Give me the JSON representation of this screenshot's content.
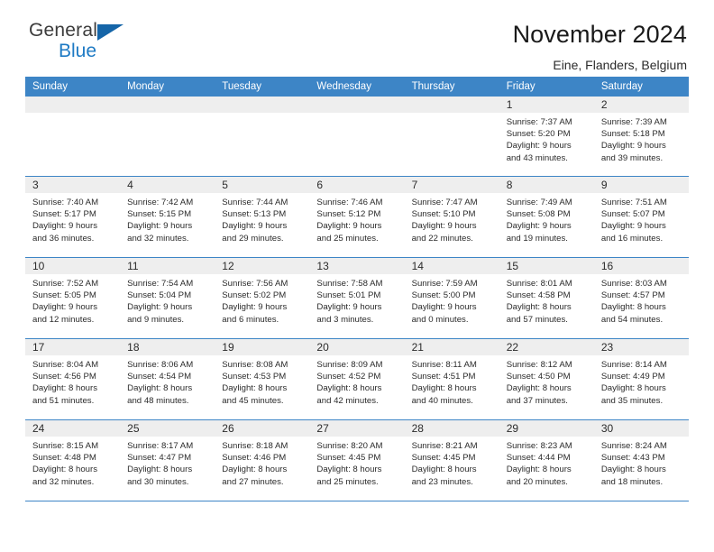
{
  "brand": {
    "name_top": "General",
    "name_bottom": "Blue",
    "triangle_color": "#1565a8",
    "blue_color": "#1e7ac4"
  },
  "header": {
    "title": "November 2024",
    "subtitle": "Eine, Flanders, Belgium"
  },
  "theme": {
    "header_blue": "#3d85c6",
    "daynum_band": "#eeeeee",
    "text": "#2b2b2b"
  },
  "weekdays": [
    "Sunday",
    "Monday",
    "Tuesday",
    "Wednesday",
    "Thursday",
    "Friday",
    "Saturday"
  ],
  "weeks": [
    [
      {
        "day": "",
        "empty": true
      },
      {
        "day": "",
        "empty": true
      },
      {
        "day": "",
        "empty": true
      },
      {
        "day": "",
        "empty": true
      },
      {
        "day": "",
        "empty": true
      },
      {
        "day": "1",
        "sunrise": "Sunrise: 7:37 AM",
        "sunset": "Sunset: 5:20 PM",
        "daylight1": "Daylight: 9 hours",
        "daylight2": "and 43 minutes."
      },
      {
        "day": "2",
        "sunrise": "Sunrise: 7:39 AM",
        "sunset": "Sunset: 5:18 PM",
        "daylight1": "Daylight: 9 hours",
        "daylight2": "and 39 minutes."
      }
    ],
    [
      {
        "day": "3",
        "sunrise": "Sunrise: 7:40 AM",
        "sunset": "Sunset: 5:17 PM",
        "daylight1": "Daylight: 9 hours",
        "daylight2": "and 36 minutes."
      },
      {
        "day": "4",
        "sunrise": "Sunrise: 7:42 AM",
        "sunset": "Sunset: 5:15 PM",
        "daylight1": "Daylight: 9 hours",
        "daylight2": "and 32 minutes."
      },
      {
        "day": "5",
        "sunrise": "Sunrise: 7:44 AM",
        "sunset": "Sunset: 5:13 PM",
        "daylight1": "Daylight: 9 hours",
        "daylight2": "and 29 minutes."
      },
      {
        "day": "6",
        "sunrise": "Sunrise: 7:46 AM",
        "sunset": "Sunset: 5:12 PM",
        "daylight1": "Daylight: 9 hours",
        "daylight2": "and 25 minutes."
      },
      {
        "day": "7",
        "sunrise": "Sunrise: 7:47 AM",
        "sunset": "Sunset: 5:10 PM",
        "daylight1": "Daylight: 9 hours",
        "daylight2": "and 22 minutes."
      },
      {
        "day": "8",
        "sunrise": "Sunrise: 7:49 AM",
        "sunset": "Sunset: 5:08 PM",
        "daylight1": "Daylight: 9 hours",
        "daylight2": "and 19 minutes."
      },
      {
        "day": "9",
        "sunrise": "Sunrise: 7:51 AM",
        "sunset": "Sunset: 5:07 PM",
        "daylight1": "Daylight: 9 hours",
        "daylight2": "and 16 minutes."
      }
    ],
    [
      {
        "day": "10",
        "sunrise": "Sunrise: 7:52 AM",
        "sunset": "Sunset: 5:05 PM",
        "daylight1": "Daylight: 9 hours",
        "daylight2": "and 12 minutes."
      },
      {
        "day": "11",
        "sunrise": "Sunrise: 7:54 AM",
        "sunset": "Sunset: 5:04 PM",
        "daylight1": "Daylight: 9 hours",
        "daylight2": "and 9 minutes."
      },
      {
        "day": "12",
        "sunrise": "Sunrise: 7:56 AM",
        "sunset": "Sunset: 5:02 PM",
        "daylight1": "Daylight: 9 hours",
        "daylight2": "and 6 minutes."
      },
      {
        "day": "13",
        "sunrise": "Sunrise: 7:58 AM",
        "sunset": "Sunset: 5:01 PM",
        "daylight1": "Daylight: 9 hours",
        "daylight2": "and 3 minutes."
      },
      {
        "day": "14",
        "sunrise": "Sunrise: 7:59 AM",
        "sunset": "Sunset: 5:00 PM",
        "daylight1": "Daylight: 9 hours",
        "daylight2": "and 0 minutes."
      },
      {
        "day": "15",
        "sunrise": "Sunrise: 8:01 AM",
        "sunset": "Sunset: 4:58 PM",
        "daylight1": "Daylight: 8 hours",
        "daylight2": "and 57 minutes."
      },
      {
        "day": "16",
        "sunrise": "Sunrise: 8:03 AM",
        "sunset": "Sunset: 4:57 PM",
        "daylight1": "Daylight: 8 hours",
        "daylight2": "and 54 minutes."
      }
    ],
    [
      {
        "day": "17",
        "sunrise": "Sunrise: 8:04 AM",
        "sunset": "Sunset: 4:56 PM",
        "daylight1": "Daylight: 8 hours",
        "daylight2": "and 51 minutes."
      },
      {
        "day": "18",
        "sunrise": "Sunrise: 8:06 AM",
        "sunset": "Sunset: 4:54 PM",
        "daylight1": "Daylight: 8 hours",
        "daylight2": "and 48 minutes."
      },
      {
        "day": "19",
        "sunrise": "Sunrise: 8:08 AM",
        "sunset": "Sunset: 4:53 PM",
        "daylight1": "Daylight: 8 hours",
        "daylight2": "and 45 minutes."
      },
      {
        "day": "20",
        "sunrise": "Sunrise: 8:09 AM",
        "sunset": "Sunset: 4:52 PM",
        "daylight1": "Daylight: 8 hours",
        "daylight2": "and 42 minutes."
      },
      {
        "day": "21",
        "sunrise": "Sunrise: 8:11 AM",
        "sunset": "Sunset: 4:51 PM",
        "daylight1": "Daylight: 8 hours",
        "daylight2": "and 40 minutes."
      },
      {
        "day": "22",
        "sunrise": "Sunrise: 8:12 AM",
        "sunset": "Sunset: 4:50 PM",
        "daylight1": "Daylight: 8 hours",
        "daylight2": "and 37 minutes."
      },
      {
        "day": "23",
        "sunrise": "Sunrise: 8:14 AM",
        "sunset": "Sunset: 4:49 PM",
        "daylight1": "Daylight: 8 hours",
        "daylight2": "and 35 minutes."
      }
    ],
    [
      {
        "day": "24",
        "sunrise": "Sunrise: 8:15 AM",
        "sunset": "Sunset: 4:48 PM",
        "daylight1": "Daylight: 8 hours",
        "daylight2": "and 32 minutes."
      },
      {
        "day": "25",
        "sunrise": "Sunrise: 8:17 AM",
        "sunset": "Sunset: 4:47 PM",
        "daylight1": "Daylight: 8 hours",
        "daylight2": "and 30 minutes."
      },
      {
        "day": "26",
        "sunrise": "Sunrise: 8:18 AM",
        "sunset": "Sunset: 4:46 PM",
        "daylight1": "Daylight: 8 hours",
        "daylight2": "and 27 minutes."
      },
      {
        "day": "27",
        "sunrise": "Sunrise: 8:20 AM",
        "sunset": "Sunset: 4:45 PM",
        "daylight1": "Daylight: 8 hours",
        "daylight2": "and 25 minutes."
      },
      {
        "day": "28",
        "sunrise": "Sunrise: 8:21 AM",
        "sunset": "Sunset: 4:45 PM",
        "daylight1": "Daylight: 8 hours",
        "daylight2": "and 23 minutes."
      },
      {
        "day": "29",
        "sunrise": "Sunrise: 8:23 AM",
        "sunset": "Sunset: 4:44 PM",
        "daylight1": "Daylight: 8 hours",
        "daylight2": "and 20 minutes."
      },
      {
        "day": "30",
        "sunrise": "Sunrise: 8:24 AM",
        "sunset": "Sunset: 4:43 PM",
        "daylight1": "Daylight: 8 hours",
        "daylight2": "and 18 minutes."
      }
    ]
  ]
}
